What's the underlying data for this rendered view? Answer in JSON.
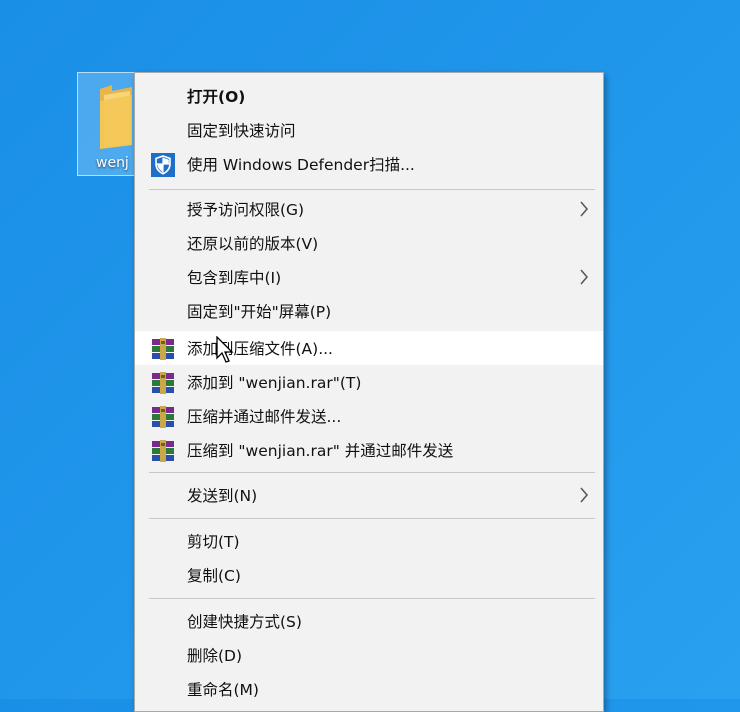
{
  "desktop": {
    "folder_label": "wenj"
  },
  "menu": {
    "items": [
      {
        "label": "打开(O)"
      },
      {
        "label": "固定到快速访问"
      },
      {
        "label": "使用 Windows Defender扫描..."
      },
      {
        "label": "授予访问权限(G)"
      },
      {
        "label": "还原以前的版本(V)"
      },
      {
        "label": "包含到库中(I)"
      },
      {
        "label": "固定到\"开始\"屏幕(P)"
      },
      {
        "label": "添加到压缩文件(A)..."
      },
      {
        "label": "添加到 \"wenjian.rar\"(T)"
      },
      {
        "label": "压缩并通过邮件发送..."
      },
      {
        "label": "压缩到 \"wenjian.rar\" 并通过邮件发送"
      },
      {
        "label": "发送到(N)"
      },
      {
        "label": "剪切(T)"
      },
      {
        "label": "复制(C)"
      },
      {
        "label": "创建快捷方式(S)"
      },
      {
        "label": "删除(D)"
      },
      {
        "label": "重命名(M)"
      }
    ],
    "icons": {
      "defender": "shield-icon",
      "winrar": "winrar-icon",
      "submenu": "chevron-right-icon"
    }
  },
  "colors": {
    "desktop_bg": "#1a8fe6",
    "menu_bg": "#f2f2f2",
    "hover_bg": "#ffffff",
    "defender_blue": "#1e6fc9"
  }
}
